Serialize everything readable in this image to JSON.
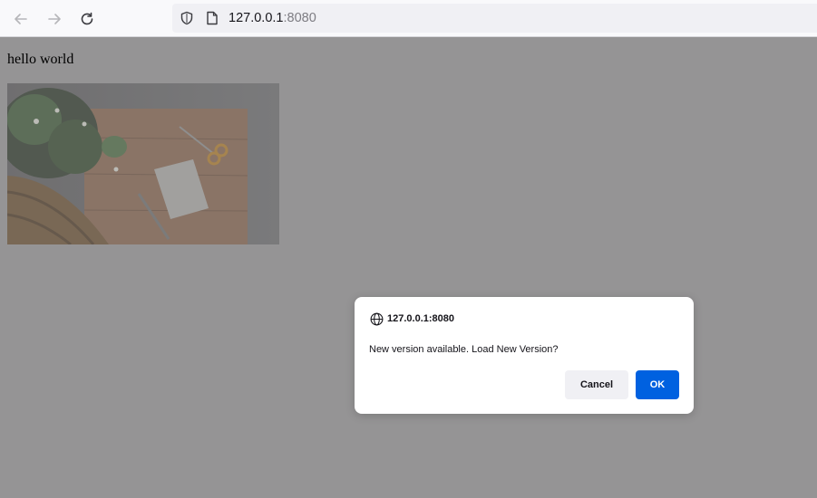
{
  "toolbar": {
    "url_host": "127.0.0.1",
    "url_port": ":8080"
  },
  "page": {
    "text": "hello world",
    "image_alt": "flowers-on-table-photo"
  },
  "dialog": {
    "origin": "127.0.0.1:8080",
    "message": "New version available. Load New Version?",
    "cancel_label": "Cancel",
    "ok_label": "OK"
  },
  "colors": {
    "overlay": "#959495",
    "ok_button": "#0061e0",
    "cancel_button": "#f0f0f4"
  }
}
